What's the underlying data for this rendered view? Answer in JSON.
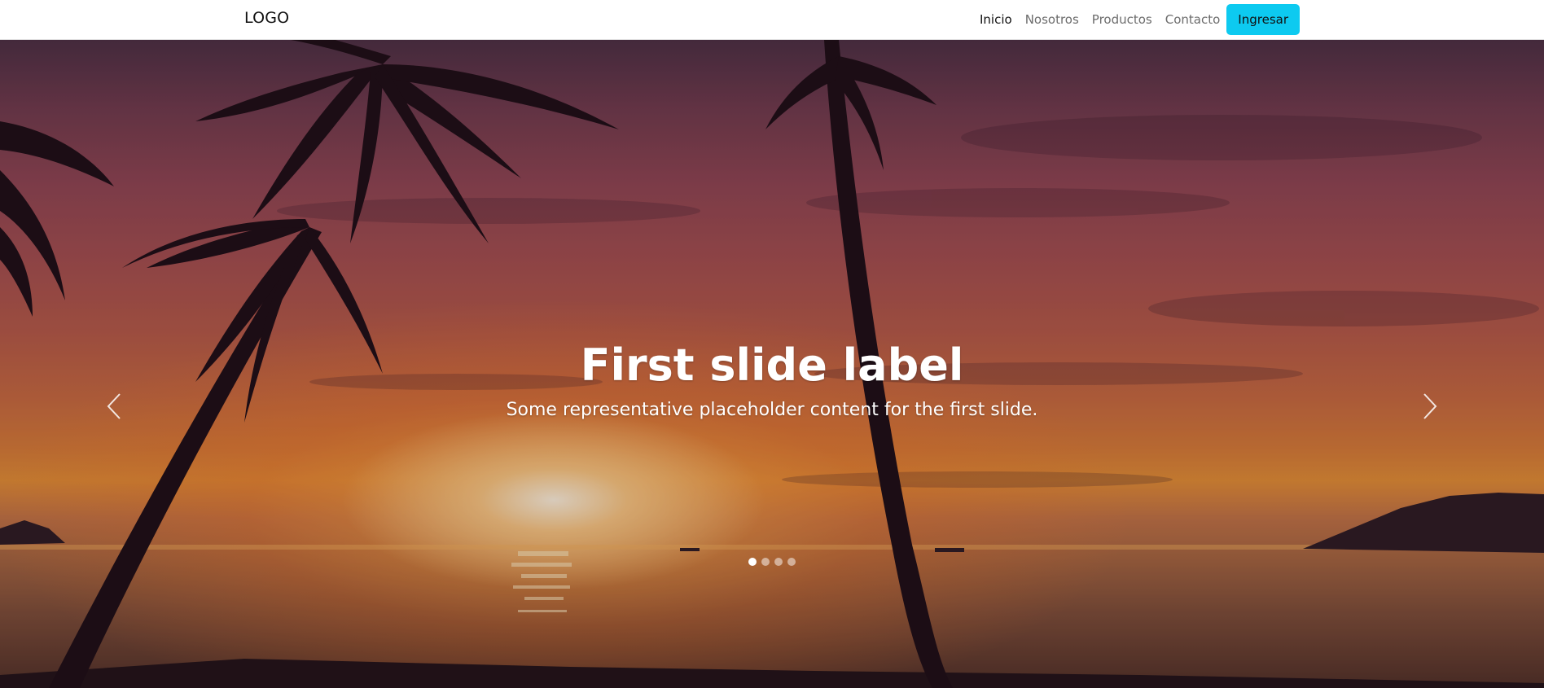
{
  "navbar": {
    "brand": "LOGO",
    "links": [
      {
        "label": "Inicio",
        "active": true
      },
      {
        "label": "Nosotros",
        "active": false
      },
      {
        "label": "Productos",
        "active": false
      },
      {
        "label": "Contacto",
        "active": false
      }
    ],
    "login_label": "Ingresar",
    "login_color": "#0dcaf0"
  },
  "carousel": {
    "slide_title": "First slide label",
    "slide_text": "Some representative placeholder content for the first slide.",
    "indicator_count": 4,
    "active_indicator": 1,
    "prev_icon": "chevron-left-icon",
    "next_icon": "chevron-right-icon",
    "background": "sunset beach with palm trees"
  }
}
